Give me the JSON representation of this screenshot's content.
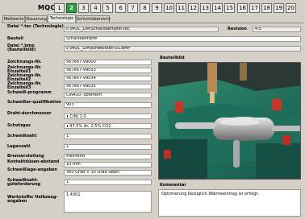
{
  "header": {
    "station_label": "MQC",
    "stations": [
      "1",
      "2",
      "3",
      "4",
      "5",
      "6",
      "7",
      "8",
      "9",
      "10",
      "11",
      "12",
      "13",
      "14",
      "15",
      "16",
      "17",
      "18",
      "19",
      "20"
    ],
    "active_station": "2"
  },
  "tabs": [
    "Meßwerte",
    "Steuerung",
    "Technologie",
    "Schichtübersicht"
  ],
  "active_tab": "Technologie",
  "form": {
    "datei_tec_label": "Datei *.tec (Technologie)",
    "datei_tec_value": "c:\\MQC_LIM\\Schalldaempfer.tec",
    "revision_label": "Revision",
    "revision_value": "4.5",
    "bauteil_label": "Bauteil",
    "bauteil_value": "Schalldaempfer",
    "datei_bmp_label": "Datei *.bmp (Bauteilbild)",
    "datei_bmp_value": "c:\\MQC_LIM\\schweißteil-01.BMP",
    "zeichnung_label": "Zeichnungs-Nr.",
    "zeichnung_value": "567667-99000",
    "einzelteil1_label": "Zeichnungs-Nr. Einzelteil1",
    "einzelteil1_value": "567667-99033",
    "einzelteil2_label": "Zeichnungs-Nr. Einzelteil2",
    "einzelteil2_value": "567667-99034",
    "einzelteil3_label": "Zeichnungs-Nr. Einzelteil3",
    "einzelteil3_value": "567667-99035",
    "schweissprogramm_label": "Schweiß-programm",
    "schweissprogramm_value": "CIN410, optimiert",
    "schweisser_label": "Schweißer-qualifikation",
    "schweisser_value": "903",
    "draht_label": "Draht-durchmesser",
    "draht_value": "CrNi 1.0",
    "schutzgas_label": "Schutzgas",
    "schutzgas_value": "97.5% Ar, 2.5% CO2",
    "schweissnaht_label": "Schweißnaht",
    "schweissnaht_value": "1",
    "lagenzahl_label": "Lagenzahl",
    "lagenzahl_value": "1",
    "brenner_label": "Brennerstellung",
    "brenner_value": "stechend",
    "kontaktduesen_label": "Kontaktdüsen-abstand",
    "kontaktduesen_value": "10 mm",
    "schweisslage_label": "Schweißlage-angaben",
    "schweisslage_value": "360 Grad + 15 Grad Überl.",
    "guete_label": "Schweißnaht-güteforderung",
    "guete_value": "1",
    "werkstoffe_label": "Werkstoffe/ Halbzeug-angaben",
    "werkstoffe_value": "1.4301"
  },
  "bauteilbild_title": "Bauteilbild",
  "kommentar_title": "Kommentar",
  "kommentar_value": "Optimierung bezüglich Wärmeeintrag ist erfolgt."
}
